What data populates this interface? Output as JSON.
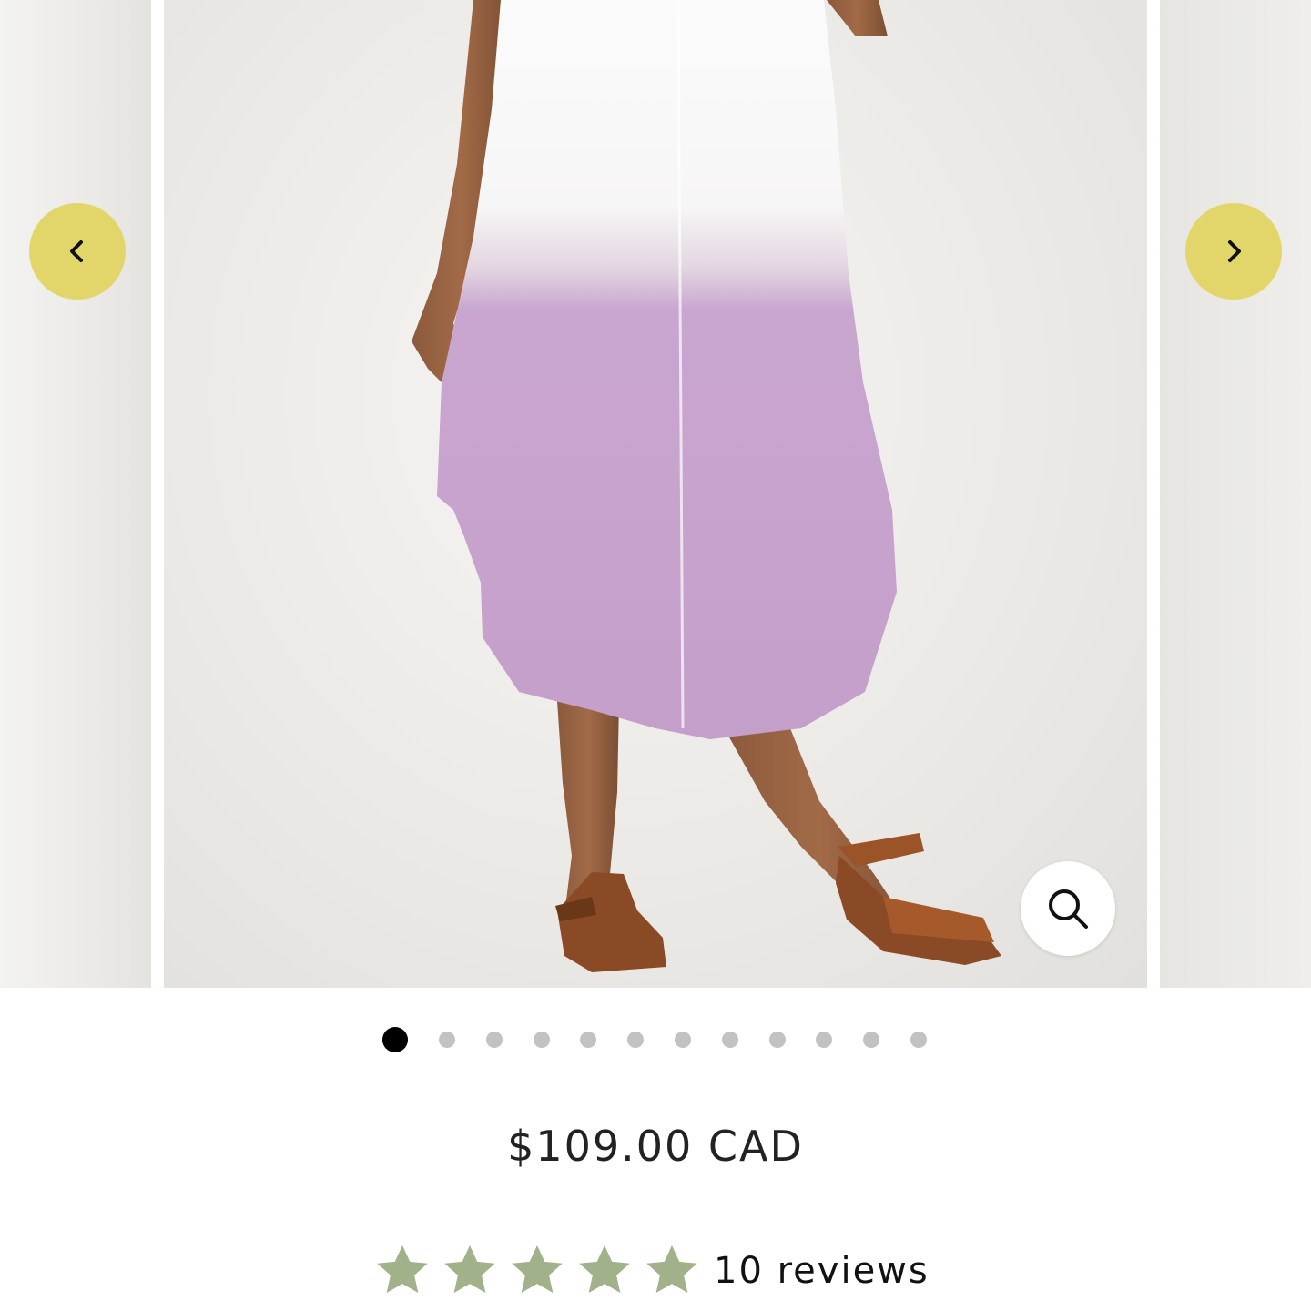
{
  "gallery": {
    "prev_label": "Previous image",
    "next_label": "Next image",
    "zoom_label": "Zoom image",
    "slide_count": 12,
    "active_index": 0,
    "arrow_color": "#e2d66a",
    "icons": {
      "prev": "chevron-left-icon",
      "next": "chevron-right-icon",
      "zoom": "search-icon"
    }
  },
  "product": {
    "price": "$109.00 CAD",
    "rating_value": 5,
    "rating_max": 5,
    "reviews_label": "10 reviews",
    "star_color": "#a1b18a",
    "dress_colors": {
      "top": "#fbfbfb",
      "dip": "#c9a6cf"
    }
  }
}
